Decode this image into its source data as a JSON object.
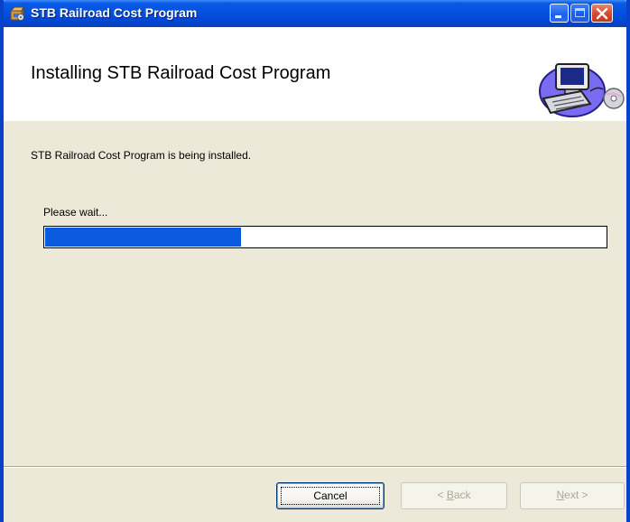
{
  "window": {
    "title": "STB Railroad Cost Program"
  },
  "banner": {
    "heading": "Installing STB Railroad Cost Program",
    "graphic_icon": "computer-installer-icon"
  },
  "body": {
    "status": "STB Railroad Cost Program is being installed.",
    "wait_label": "Please wait...",
    "progress_fraction": 0.35
  },
  "buttons": {
    "cancel": "Cancel",
    "back_prefix": "< ",
    "back_mnemonic": "B",
    "back_rest": "ack",
    "next_mnemonic": "N",
    "next_rest": "ext >"
  },
  "colors": {
    "titlebar": "#0553e0",
    "progress_fill": "#0a5ae0",
    "face": "#ece9d8"
  },
  "icons": {
    "title": "installer-box-icon",
    "minimize": "minimize-icon",
    "maximize": "maximize-icon",
    "close": "close-icon"
  }
}
